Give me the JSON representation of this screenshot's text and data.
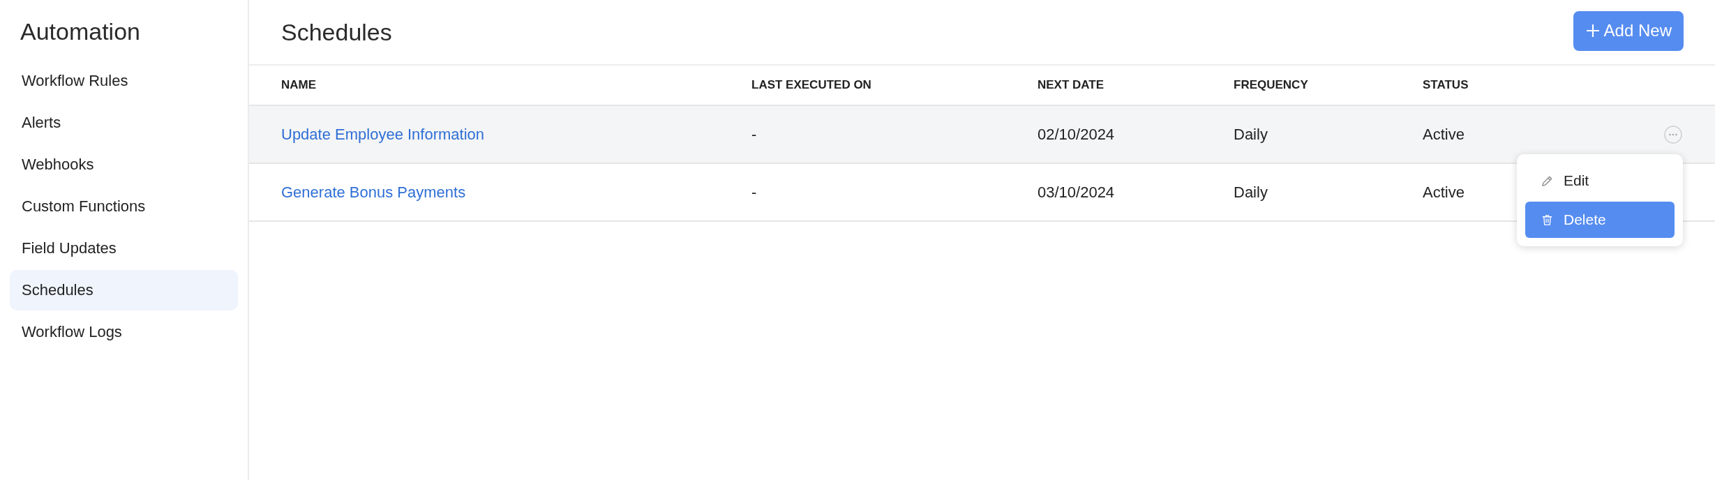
{
  "sidebar": {
    "title": "Automation",
    "items": [
      {
        "label": "Workflow Rules",
        "selected": false
      },
      {
        "label": "Alerts",
        "selected": false
      },
      {
        "label": "Webhooks",
        "selected": false
      },
      {
        "label": "Custom Functions",
        "selected": false
      },
      {
        "label": "Field Updates",
        "selected": false
      },
      {
        "label": "Schedules",
        "selected": true
      },
      {
        "label": "Workflow Logs",
        "selected": false
      }
    ]
  },
  "page": {
    "title": "Schedules",
    "add_button": "Add New"
  },
  "table": {
    "columns": [
      "NAME",
      "LAST EXECUTED ON",
      "NEXT DATE",
      "FREQUENCY",
      "STATUS"
    ],
    "rows": [
      {
        "name": "Update Employee Information",
        "last_executed_on": "-",
        "next_date": "02/10/2024",
        "frequency": "Daily",
        "status": "Active",
        "menu_open": true
      },
      {
        "name": "Generate Bonus Payments",
        "last_executed_on": "-",
        "next_date": "03/10/2024",
        "frequency": "Daily",
        "status": "Active",
        "menu_open": false
      }
    ]
  },
  "row_menu": {
    "items": [
      {
        "kind": "edit",
        "label": "Edit",
        "highlighted": false
      },
      {
        "kind": "delete",
        "label": "Delete",
        "highlighted": true
      }
    ]
  }
}
